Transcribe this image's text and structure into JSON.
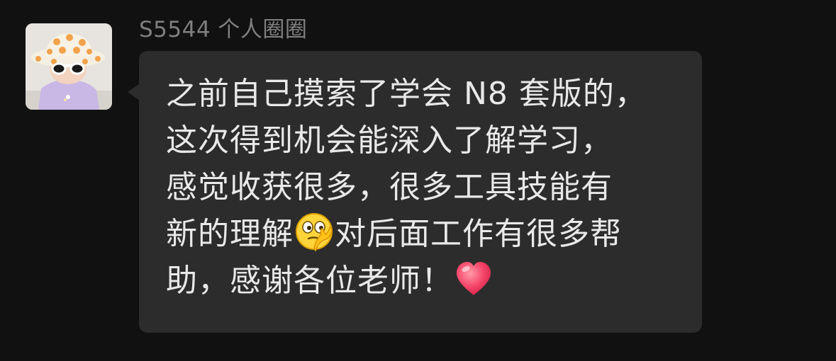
{
  "sender": {
    "name": "S5544 个人圈圈"
  },
  "message": {
    "line1": "之前自己摸索了学会 N8 套版的，",
    "line2": "这次得到机会能深入了解学习，",
    "line3": "感觉收获很多，很多工具技能有",
    "line4_before_emoji": "新的理解",
    "line4_after_emoji": "对后面工作有很多帮",
    "line5": "助，感谢各位老师！",
    "emojis": [
      "thinking-face-emoji",
      "heart-emoji"
    ]
  },
  "colors": {
    "background": "#111111",
    "bubble": "#2c2c2c",
    "message_text": "#e9e9e9",
    "sender_name": "#7f7f7f"
  }
}
